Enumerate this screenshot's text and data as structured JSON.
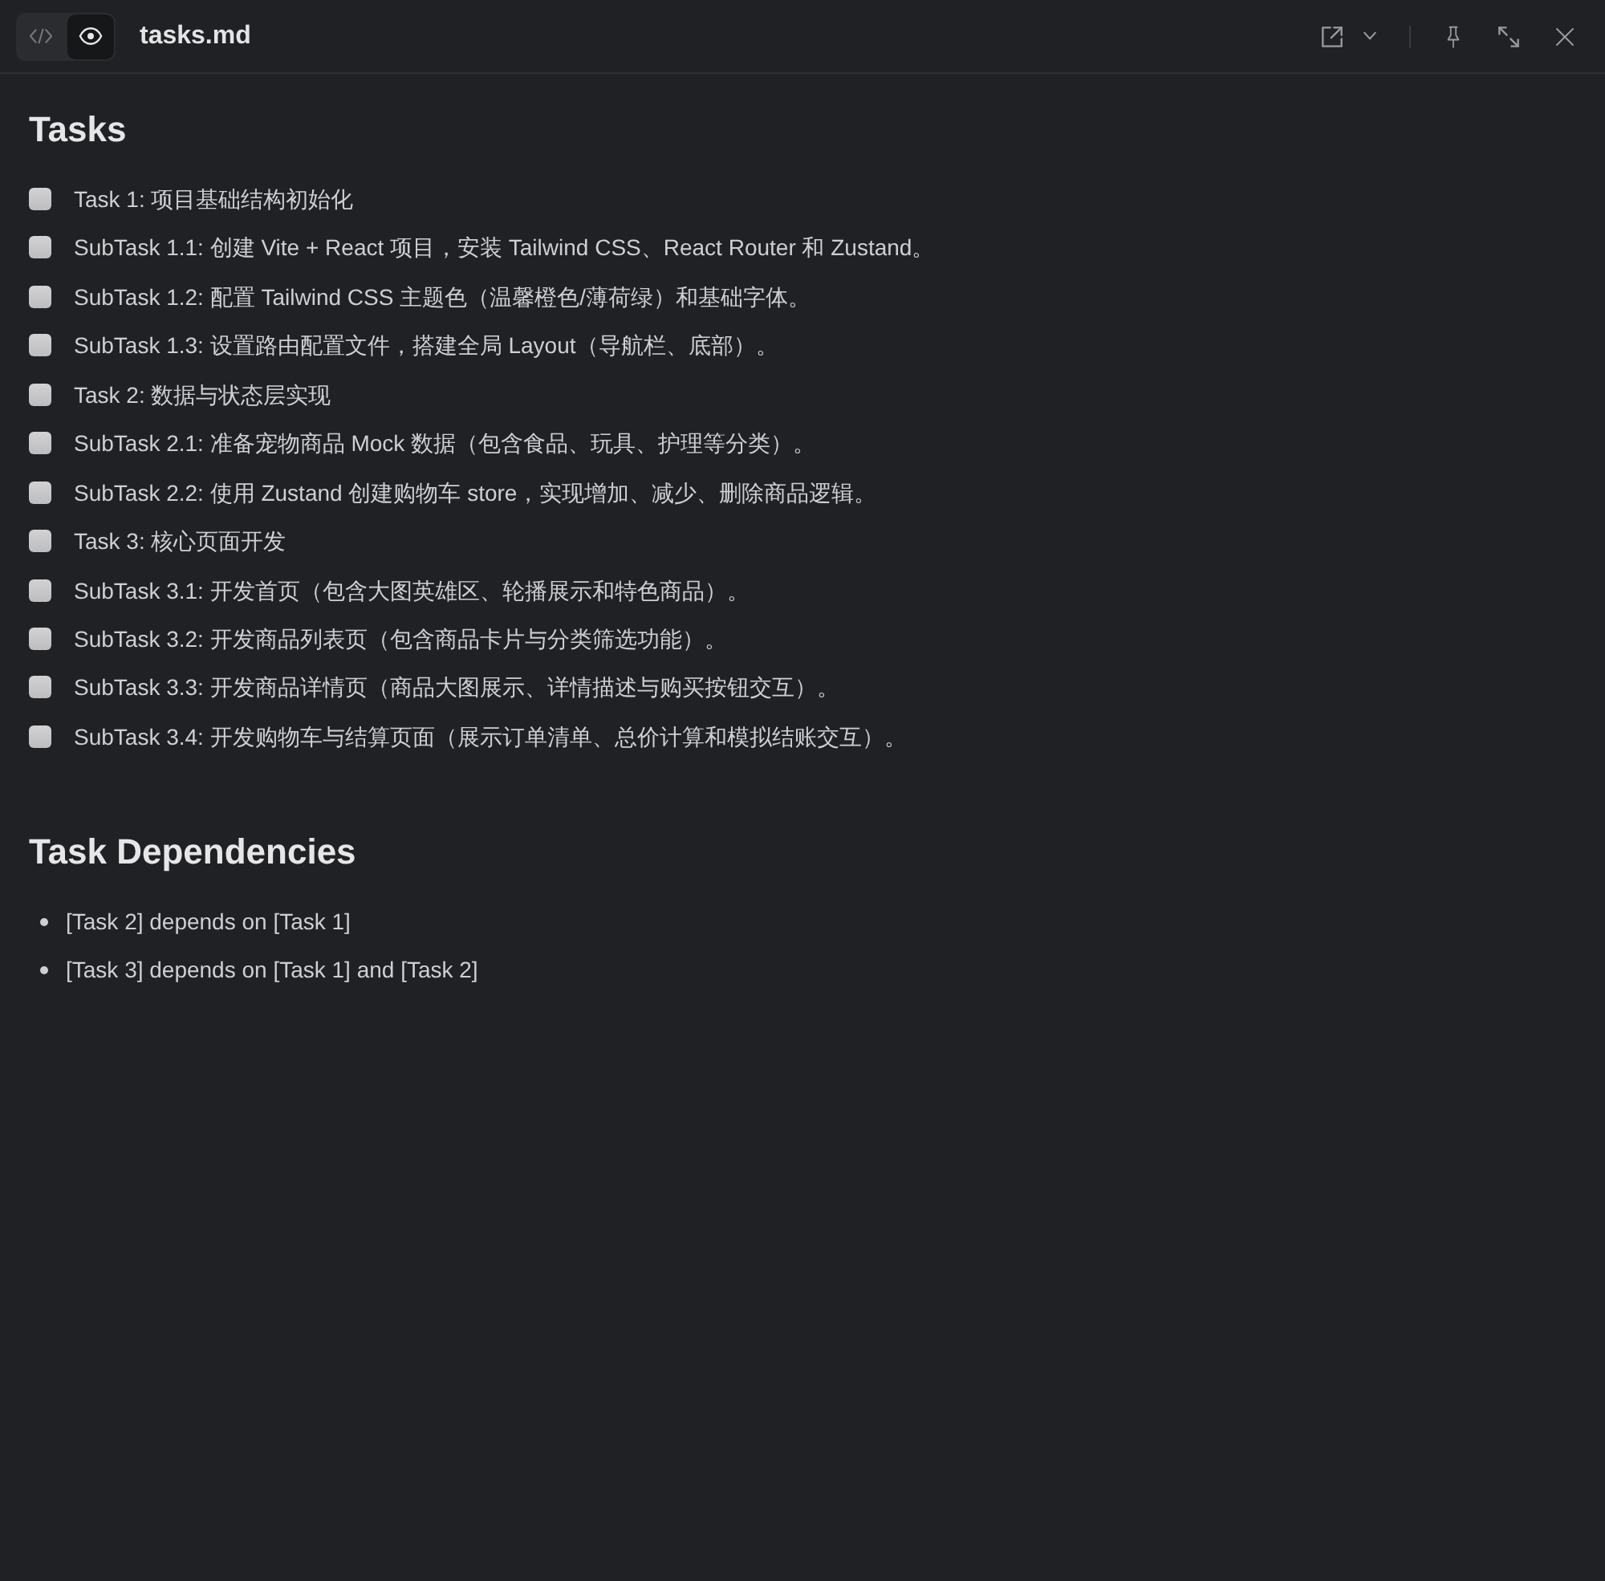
{
  "toolbar": {
    "view_modes": [
      {
        "kind": "source",
        "selected": false
      },
      {
        "kind": "preview",
        "selected": true
      }
    ],
    "title": "tasks.md",
    "action_groups": [
      [
        {
          "kind": "open-external"
        },
        {
          "kind": "dropdown"
        }
      ],
      [
        {
          "kind": "pin"
        },
        {
          "kind": "expand"
        },
        {
          "kind": "close"
        }
      ]
    ]
  },
  "document": {
    "sections": [
      {
        "kind": "checklist",
        "heading": "Tasks",
        "items": [
          {
            "text": "Task 1: 项目基础结构初始化",
            "checked": false
          },
          {
            "text": "SubTask 1.1: 创建 Vite + React 项目，安装 Tailwind CSS、React Router 和 Zustand。",
            "checked": false
          },
          {
            "text": "SubTask 1.2: 配置 Tailwind CSS 主题色（温馨橙色/薄荷绿）和基础字体。",
            "checked": false
          },
          {
            "text": "SubTask 1.3: 设置路由配置文件，搭建全局 Layout（导航栏、底部）。",
            "checked": false
          },
          {
            "text": "Task 2: 数据与状态层实现",
            "checked": false
          },
          {
            "text": "SubTask 2.1: 准备宠物商品 Mock 数据（包含食品、玩具、护理等分类）。",
            "checked": false
          },
          {
            "text": "SubTask 2.2: 使用 Zustand 创建购物车 store，实现增加、减少、删除商品逻辑。",
            "checked": false
          },
          {
            "text": "Task 3: 核心页面开发",
            "checked": false
          },
          {
            "text": "SubTask 3.1: 开发首页（包含大图英雄区、轮播展示和特色商品）。",
            "checked": false
          },
          {
            "text": "SubTask 3.2: 开发商品列表页（包含商品卡片与分类筛选功能）。",
            "checked": false
          },
          {
            "text": "SubTask 3.3: 开发商品详情页（商品大图展示、详情描述与购买按钮交互）。",
            "checked": false
          },
          {
            "text": "SubTask 3.4: 开发购物车与结算页面（展示订单清单、总价计算和模拟结账交互）。",
            "checked": false
          }
        ]
      },
      {
        "kind": "bullets",
        "heading": "Task Dependencies",
        "items": [
          {
            "text": "[Task 2] depends on [Task 1]"
          },
          {
            "text": "[Task 3] depends on [Task 1] and [Task 2]"
          }
        ]
      }
    ]
  }
}
